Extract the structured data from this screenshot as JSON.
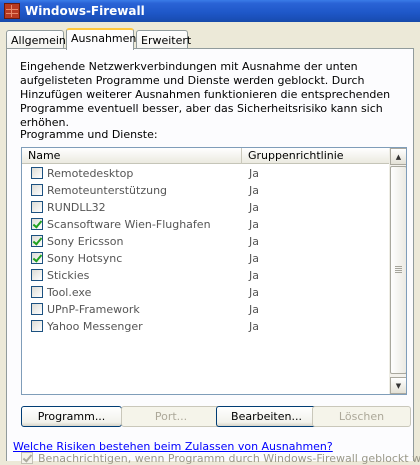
{
  "window": {
    "title": "Windows-Firewall",
    "icon": "firewall-icon"
  },
  "tabs": [
    {
      "label": "Allgemein",
      "active": false
    },
    {
      "label": "Ausnahmen",
      "active": true
    },
    {
      "label": "Erweitert",
      "active": false
    }
  ],
  "description": "Eingehende Netzwerkverbindungen mit Ausnahme der unten aufgelisteten Programme und Dienste werden geblockt. Durch Hinzufügen weiterer Ausnahmen funktionieren die entsprechenden Programme eventuell besser, aber das Sicherheitsrisiko kann sich erhöhen.",
  "list": {
    "label": "Programme und Dienste:",
    "columns": {
      "name": "Name",
      "group": "Gruppenrichtlinie"
    },
    "rows": [
      {
        "name": "Remotedesktop",
        "group": "Ja",
        "checked": false
      },
      {
        "name": "Remoteunterstützung",
        "group": "Ja",
        "checked": false
      },
      {
        "name": "RUNDLL32",
        "group": "Ja",
        "checked": false
      },
      {
        "name": "Scansoftware Wien-Flughafen",
        "group": "Ja",
        "checked": true
      },
      {
        "name": "Sony Ericsson",
        "group": "Ja",
        "checked": true
      },
      {
        "name": "Sony Hotsync",
        "group": "Ja",
        "checked": true
      },
      {
        "name": "Stickies",
        "group": "Ja",
        "checked": false
      },
      {
        "name": "Tool.exe",
        "group": "Ja",
        "checked": false
      },
      {
        "name": "UPnP-Framework",
        "group": "Ja",
        "checked": false
      },
      {
        "name": "Yahoo Messenger",
        "group": "Ja",
        "checked": false
      }
    ]
  },
  "buttons": {
    "programm": "Programm...",
    "port": "Port...",
    "bearbeiten": "Bearbeiten...",
    "loeschen": "Löschen"
  },
  "notify": {
    "label": "Benachrichtigen, wenn Programm durch Windows-Firewall geblockt wird",
    "checked": true
  },
  "link": "Welche Risiken bestehen beim Zulassen von Ausnahmen?"
}
